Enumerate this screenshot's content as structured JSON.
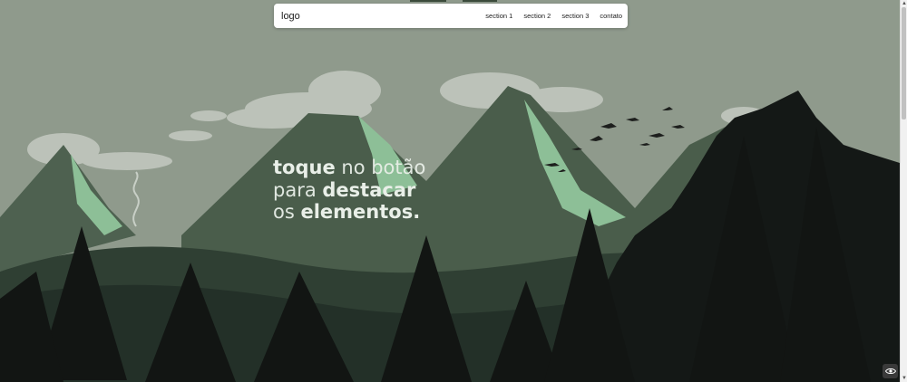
{
  "header": {
    "logo": "logo",
    "nav": [
      {
        "label": "section 1"
      },
      {
        "label": "section 2"
      },
      {
        "label": "section 3"
      },
      {
        "label": "contato"
      }
    ]
  },
  "hero": {
    "line1_strong": "toque",
    "line1_light": " no botão",
    "line2_light": "para ",
    "line2_strong": "destacar",
    "line3_light": "os ",
    "line3_strong": "elementos."
  },
  "colors": {
    "sky": "#8f9a8c",
    "mountain_dark": "#4a5d4b",
    "mountain_light": "#8dbf97",
    "forest_dark": "#1a1f1c",
    "hero_text": "#e9efe8"
  },
  "icons": {
    "toggle": "eye-icon"
  }
}
